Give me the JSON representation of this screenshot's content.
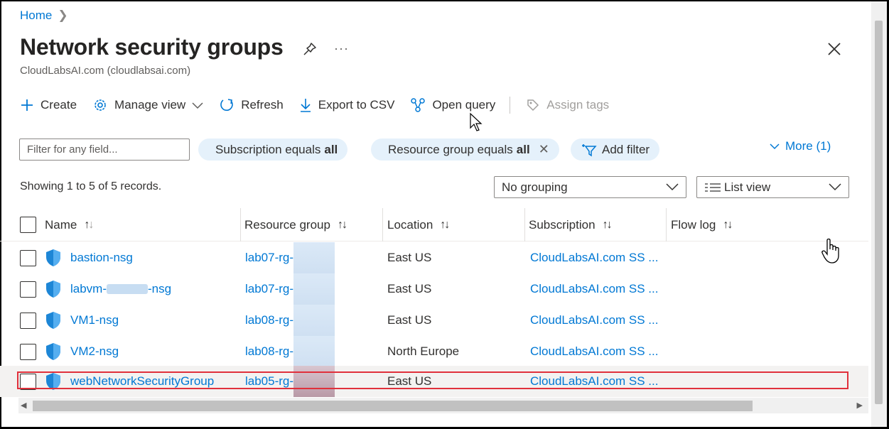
{
  "breadcrumb": {
    "home": "Home"
  },
  "header": {
    "title": "Network security groups",
    "subtitle": "CloudLabsAI.com (cloudlabsai.com)",
    "more": "···"
  },
  "toolbar": {
    "create": "Create",
    "manage_view": "Manage view",
    "refresh": "Refresh",
    "export_csv": "Export to CSV",
    "open_query": "Open query",
    "assign_tags": "Assign tags"
  },
  "filters": {
    "placeholder": "Filter for any field...",
    "subscription_label": "Subscription equals",
    "subscription_value": "all",
    "resource_group_label": "Resource group equals",
    "resource_group_value": "all",
    "add_filter": "Add filter",
    "more": "More (1)"
  },
  "records_text": "Showing 1 to 5 of 5 records.",
  "grouping": "No grouping",
  "view_mode": "List view",
  "columns": {
    "name": "Name",
    "resource_group": "Resource group",
    "location": "Location",
    "subscription": "Subscription",
    "flow_log": "Flow log"
  },
  "rows": [
    {
      "name": "bastion-nsg",
      "resource_group": "lab07-rg-",
      "location": "East US",
      "subscription": "CloudLabsAI.com SS ..."
    },
    {
      "name_prefix": "labvm-",
      "name_suffix": "-nsg",
      "resource_group": "lab07-rg-",
      "location": "East US",
      "subscription": "CloudLabsAI.com SS ..."
    },
    {
      "name": "VM1-nsg",
      "resource_group": "lab08-rg-",
      "location": "East US",
      "subscription": "CloudLabsAI.com SS ..."
    },
    {
      "name": "VM2-nsg",
      "resource_group": "lab08-rg-",
      "location": "North Europe",
      "subscription": "CloudLabsAI.com SS ..."
    },
    {
      "name": "webNetworkSecurityGroup",
      "resource_group": "lab05-rg-",
      "location": "East US",
      "subscription": "CloudLabsAI.com SS ..."
    }
  ],
  "colors": {
    "link": "#0078d4",
    "pill_bg": "#e5f1fb",
    "highlight": "#e0303b"
  }
}
